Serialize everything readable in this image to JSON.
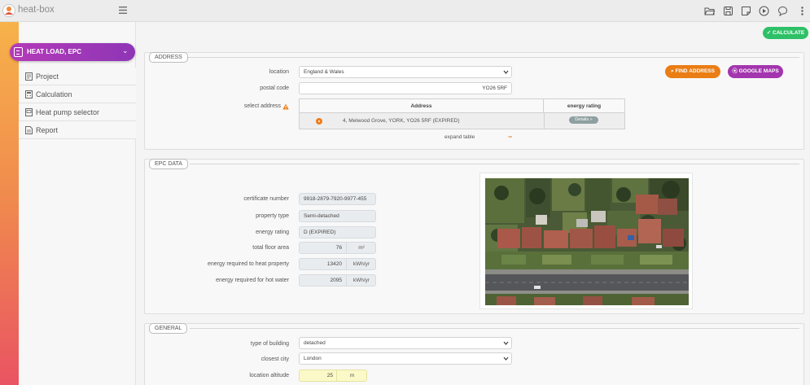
{
  "app": {
    "name": "heat-box"
  },
  "toolbar": {
    "icons": [
      "folder-open-icon",
      "save-icon",
      "note-icon",
      "play-icon",
      "chat-icon",
      "more-vert-icon"
    ]
  },
  "sidebar": {
    "section": "HEAT LOAD, EPC",
    "items": [
      {
        "label": "Project",
        "icon": "document-icon"
      },
      {
        "label": "Calculation",
        "icon": "calculator-icon"
      },
      {
        "label": "Heat pump selector",
        "icon": "heat-pump-icon"
      },
      {
        "label": "Report",
        "icon": "report-icon"
      }
    ]
  },
  "actions": {
    "calculate": "✓ CALCULATE",
    "find_address": "⌕ FIND ADDRESS",
    "google_maps": "⦿ GOOGLE MAPS"
  },
  "address": {
    "tab": "ADDRESS",
    "location_label": "location",
    "location_value": "England & Wales",
    "postal_code_label": "postal code",
    "postal_code_value": "YO26 5RF",
    "select_label": "select address",
    "warning_icon": "warning-icon",
    "table": {
      "col_address": "Address",
      "col_rating": "energy rating",
      "rows": [
        {
          "address": "4, Melwood Grove, YORK, YO26 5RF (EXPIRED)",
          "details": "Details »"
        }
      ]
    },
    "expand_label": "expand table",
    "expand_symbol": "−"
  },
  "epc": {
    "tab": "EPC DATA",
    "certificate_label": "certificate number",
    "certificate_value": "9918-2879-7920-9977-455",
    "property_type_label": "property type",
    "property_type_value": "Semi-detached",
    "energy_rating_label": "energy rating",
    "energy_rating_value": "D (EXPIRED)",
    "floor_area_label": "total floor area",
    "floor_area_value": "76",
    "floor_area_unit": "m²",
    "heat_label": "energy required to heat property",
    "heat_value": "13420",
    "heat_unit": "kWh/yr",
    "water_label": "energy required for hot water",
    "water_value": "2095",
    "water_unit": "kWh/yr"
  },
  "general": {
    "tab": "GENERAL",
    "building_label": "type of building",
    "building_value": "detached",
    "city_label": "closest city",
    "city_value": "London",
    "altitude_label": "location altitude",
    "altitude_value": "25",
    "altitude_unit": "m"
  },
  "colors": {
    "accent_purple": "#a335ae",
    "accent_orange": "#ea7d14",
    "accent_green": "#2ec067",
    "warning_yellow": "#fbf9c8"
  }
}
